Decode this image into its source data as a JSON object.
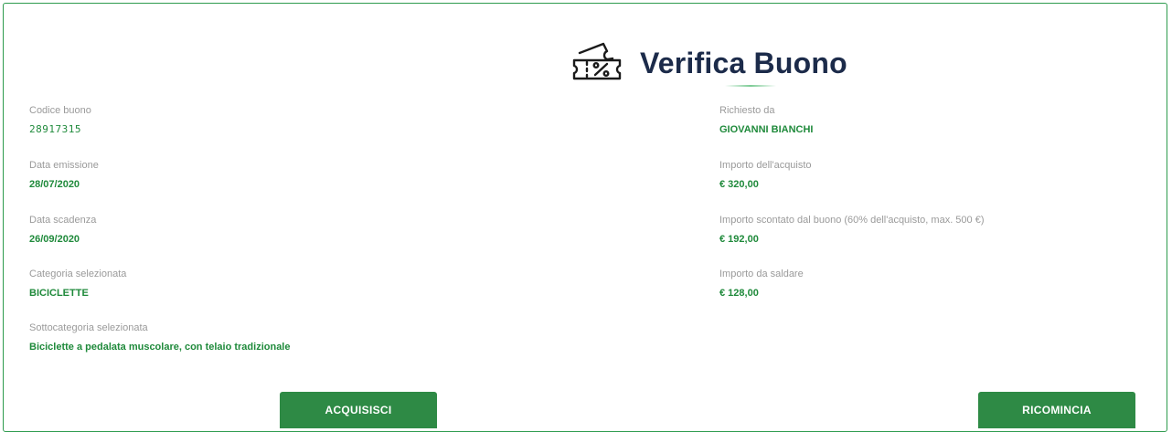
{
  "header": {
    "icon": "ticket-discount-icon",
    "title": "Verifica Buono"
  },
  "left_fields": [
    {
      "label": "Codice buono",
      "value": "28917315"
    },
    {
      "label": "Data emissione",
      "value": "28/07/2020"
    },
    {
      "label": "Data scadenza",
      "value": "26/09/2020"
    },
    {
      "label": "Categoria selezionata",
      "value": "BICICLETTE"
    },
    {
      "label": "Sottocategoria selezionata",
      "value": "Biciclette a pedalata muscolare, con telaio tradizionale"
    }
  ],
  "right_fields": [
    {
      "label": "Richiesto da",
      "value": "GIOVANNI BIANCHI"
    },
    {
      "label": "Importo dell'acquisto",
      "value": "€ 320,00"
    },
    {
      "label": "Importo scontato dal buono (60% dell'acquisto, max. 500 €)",
      "value": "€ 192,00"
    },
    {
      "label": "Importo da saldare",
      "value": "€ 128,00"
    }
  ],
  "actions": {
    "acquire_label": "ACQUISISCI",
    "restart_label": "RICOMINCIA"
  },
  "colors": {
    "accent": "#2e8a45",
    "value_text": "#1f8a3b",
    "label_text": "#9a9a9a",
    "title_text": "#1c2b4a",
    "border": "#2e9b4e"
  }
}
